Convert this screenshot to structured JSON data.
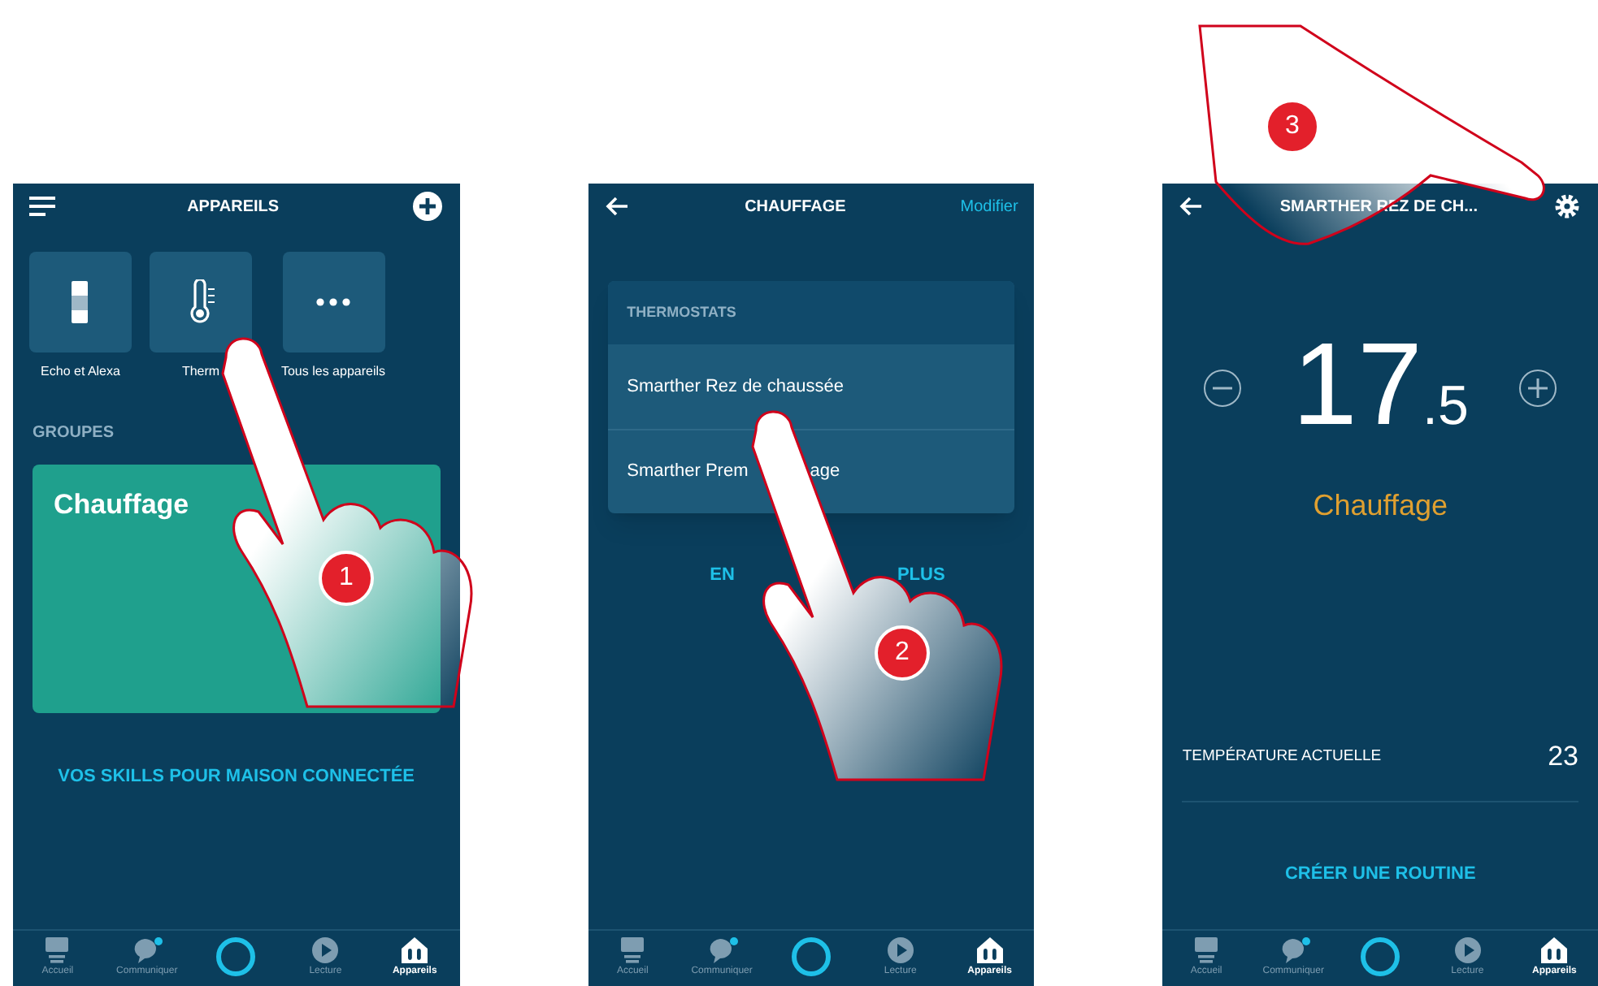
{
  "devices_screen": {
    "title": "APPAREILS",
    "tiles": [
      {
        "kind": "echo",
        "label": "Echo et Alexa"
      },
      {
        "kind": "thermometer",
        "label": "Therm"
      },
      {
        "kind": "more",
        "label": "Tous les appareils"
      }
    ],
    "section_heading": "GROUPES",
    "group_card": {
      "title": "Chauffage"
    },
    "link": "VOS SKILLS POUR MAISON CONNECTÉE",
    "nav": [
      {
        "kind": "home",
        "label": "Accueil",
        "selected": false,
        "notification": false
      },
      {
        "kind": "chat",
        "label": "Communiquer",
        "selected": false,
        "notification": true
      },
      {
        "kind": "alexa",
        "selected": false,
        "notification": false
      },
      {
        "kind": "play",
        "label": "Lecture",
        "selected": false,
        "notification": false
      },
      {
        "kind": "devices",
        "label": "Appareils",
        "selected": true,
        "notification": false
      }
    ]
  },
  "group_screen": {
    "title": "CHAUFFAGE",
    "action": "Modifier",
    "list_heading": "THERMOSTATS",
    "items": [
      {
        "parts": [
          "Smarther Rez de chaussée"
        ]
      },
      {
        "parts": [
          "Smarther Prem",
          "age"
        ]
      }
    ],
    "link_parts": [
      "EN",
      "PLUS"
    ],
    "nav": [
      {
        "kind": "home",
        "label": "Accueil",
        "selected": false,
        "notification": false
      },
      {
        "kind": "chat",
        "label": "Communiquer",
        "selected": false,
        "notification": true
      },
      {
        "kind": "alexa",
        "selected": false,
        "notification": false
      },
      {
        "kind": "play",
        "label": "Lecture",
        "selected": false,
        "notification": false
      },
      {
        "kind": "devices",
        "label": "Appareils",
        "selected": true,
        "notification": false
      }
    ]
  },
  "thermostat_screen": {
    "title": "SMARTHER REZ DE CH...",
    "setpoint": "17",
    "setpoint_decimal": ".5",
    "mode": "Chauffage",
    "current_label": "TEMPÉRATURE ACTUELLE",
    "current_value": "23",
    "link": "CRÉER UNE ROUTINE",
    "nav": [
      {
        "kind": "home",
        "label": "Accueil",
        "selected": false,
        "notification": false
      },
      {
        "kind": "chat",
        "label": "Communiquer",
        "selected": false,
        "notification": true
      },
      {
        "kind": "alexa",
        "selected": false,
        "notification": false
      },
      {
        "kind": "play",
        "label": "Lecture",
        "selected": false,
        "notification": false
      },
      {
        "kind": "devices",
        "label": "Appareils",
        "selected": true,
        "notification": false
      }
    ]
  },
  "steps": [
    "1",
    "2",
    "3"
  ]
}
